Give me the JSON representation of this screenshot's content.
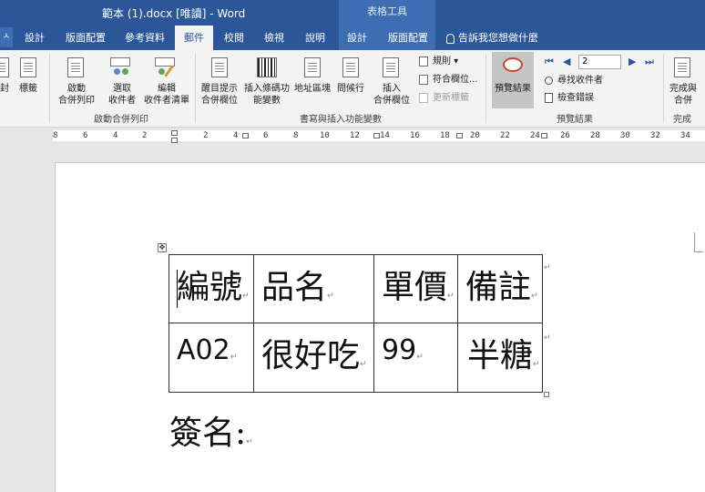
{
  "window": {
    "title": "範本 (1).docx [唯讀]  -  Word",
    "context_header": "表格工具"
  },
  "tabs": [
    {
      "label": "設計"
    },
    {
      "label": "版面配置"
    },
    {
      "label": "參考資料"
    },
    {
      "label": "郵件",
      "active": true
    },
    {
      "label": "校閱"
    },
    {
      "label": "檢視"
    },
    {
      "label": "說明"
    },
    {
      "label": "設計"
    },
    {
      "label": "版面配置"
    }
  ],
  "file_chip": "ㅅ",
  "tell_me": "告訴我您想做什麼",
  "ribbon": {
    "partial_left": "封",
    "labels_btn": "標籤",
    "start_merge": [
      "啟動",
      "合併列印"
    ],
    "select_recipients": [
      "選取",
      "收件者"
    ],
    "edit_list": [
      "編輯",
      "收件者清單"
    ],
    "group_start": "啟動合併列印",
    "highlight": [
      "醒目提示",
      "合併欄位"
    ],
    "barcode": [
      "插入條碼功",
      "能變數"
    ],
    "address_block": "地址區塊",
    "greeting": "問候行",
    "insert_field": [
      "插入",
      "合併欄位"
    ],
    "rules": "規則",
    "match_fields": "符合欄位...",
    "update_labels": "更新標籤",
    "group_write": "書寫與插入功能變數",
    "preview_results": "預覽結果",
    "record_value": "2",
    "find_recipient": "尋找收件者",
    "check_errors": "檢查錯誤",
    "group_preview": "預覽結果",
    "finish": [
      "完成與",
      "合併"
    ],
    "group_finish": "完成"
  },
  "ruler_numbers": [
    "8",
    "6",
    "4",
    "2",
    "2",
    "4",
    "6",
    "8",
    "10",
    "12",
    "14",
    "16",
    "18",
    "20",
    "22",
    "24",
    "26",
    "28",
    "30",
    "32",
    "34"
  ],
  "table": {
    "rows": [
      [
        "編號",
        "品名",
        "單價",
        "備註"
      ],
      [
        "A02",
        "很好吃",
        "99",
        "半糖"
      ]
    ]
  },
  "signature_label": "簽名:",
  "colors": {
    "ribbon_blue": "#2b579a",
    "context_blue": "#3e6db3"
  }
}
